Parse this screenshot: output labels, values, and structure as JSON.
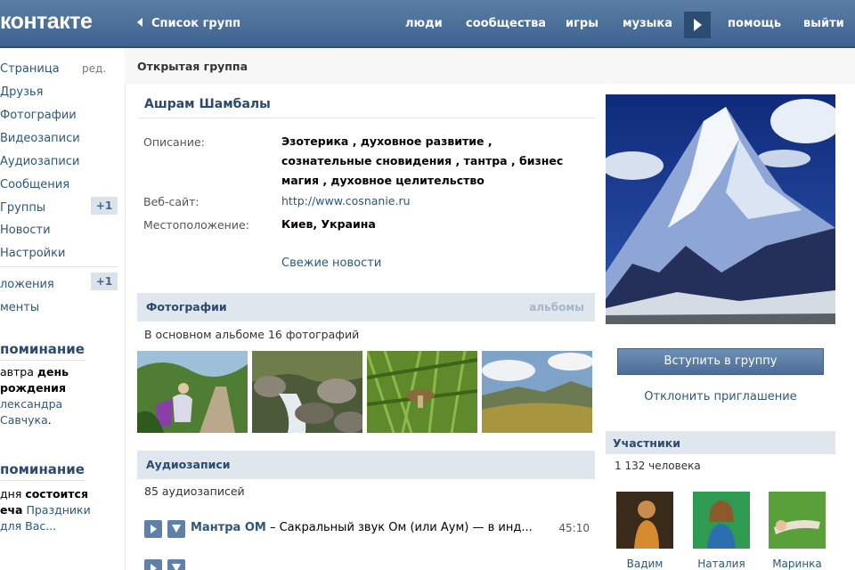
{
  "header": {
    "logo": "контакте",
    "back_label": "Список групп",
    "nav": [
      "люди",
      "сообщества",
      "игры",
      "музыка",
      "помощь",
      "выйти"
    ]
  },
  "left_menu": {
    "edit_label": "ред.",
    "items": [
      "Страница",
      "Друзья",
      "Фотографии",
      "Видеозаписи",
      "Аудиозаписи",
      "Сообщения",
      "Группы",
      "Новости",
      "Настройки"
    ],
    "groups_badge": "+1",
    "apps_label": "ложения",
    "apps_badge": "+1",
    "extra_label": "менты",
    "reminder1": {
      "title": "поминание",
      "line1_pre": "автра ",
      "line1_b": "день",
      "line2_b": "рождения",
      "line3_link": "лександра",
      "line4_link": "Савчука",
      "line4_post": "."
    },
    "reminder2": {
      "title": "поминание",
      "line1_pre": "дня ",
      "line1_b": "состоится",
      "line2_b": "еча",
      "line2_link": " Праздники",
      "line3_link": "для Вас..."
    }
  },
  "group": {
    "type": "Открытая группа",
    "name": "Ашрам Шамбалы",
    "description_label": "Описание:",
    "description": "Эзотерика , духовное развитие , сознательные сновидения , тантра , бизнес магия , духовное целительство",
    "website_label": "Веб-сайт:",
    "website": "http://www.cosnanie.ru",
    "location_label": "Местоположение:",
    "location": "Киев, Украина",
    "news_link": "Свежие новости"
  },
  "photos": {
    "title": "Фотографии",
    "albums_link": "альбомы",
    "summary": "В основном альбоме 16 фотографий"
  },
  "audio": {
    "title": "Аудиозаписи",
    "summary": "85 аудиозаписей",
    "tracks": [
      {
        "artist": "Мантра ОМ",
        "title": " – Сакральный звук Ом (или Аум) — в инд...",
        "duration": "45:10"
      }
    ]
  },
  "sidebar_right": {
    "join_button": "Вступить в группу",
    "decline_link": "Отклонить приглашение",
    "members_title": "Участники",
    "members_count": "1 132 человека",
    "members": [
      "Вадим",
      "Наталия",
      "Маринка"
    ]
  }
}
